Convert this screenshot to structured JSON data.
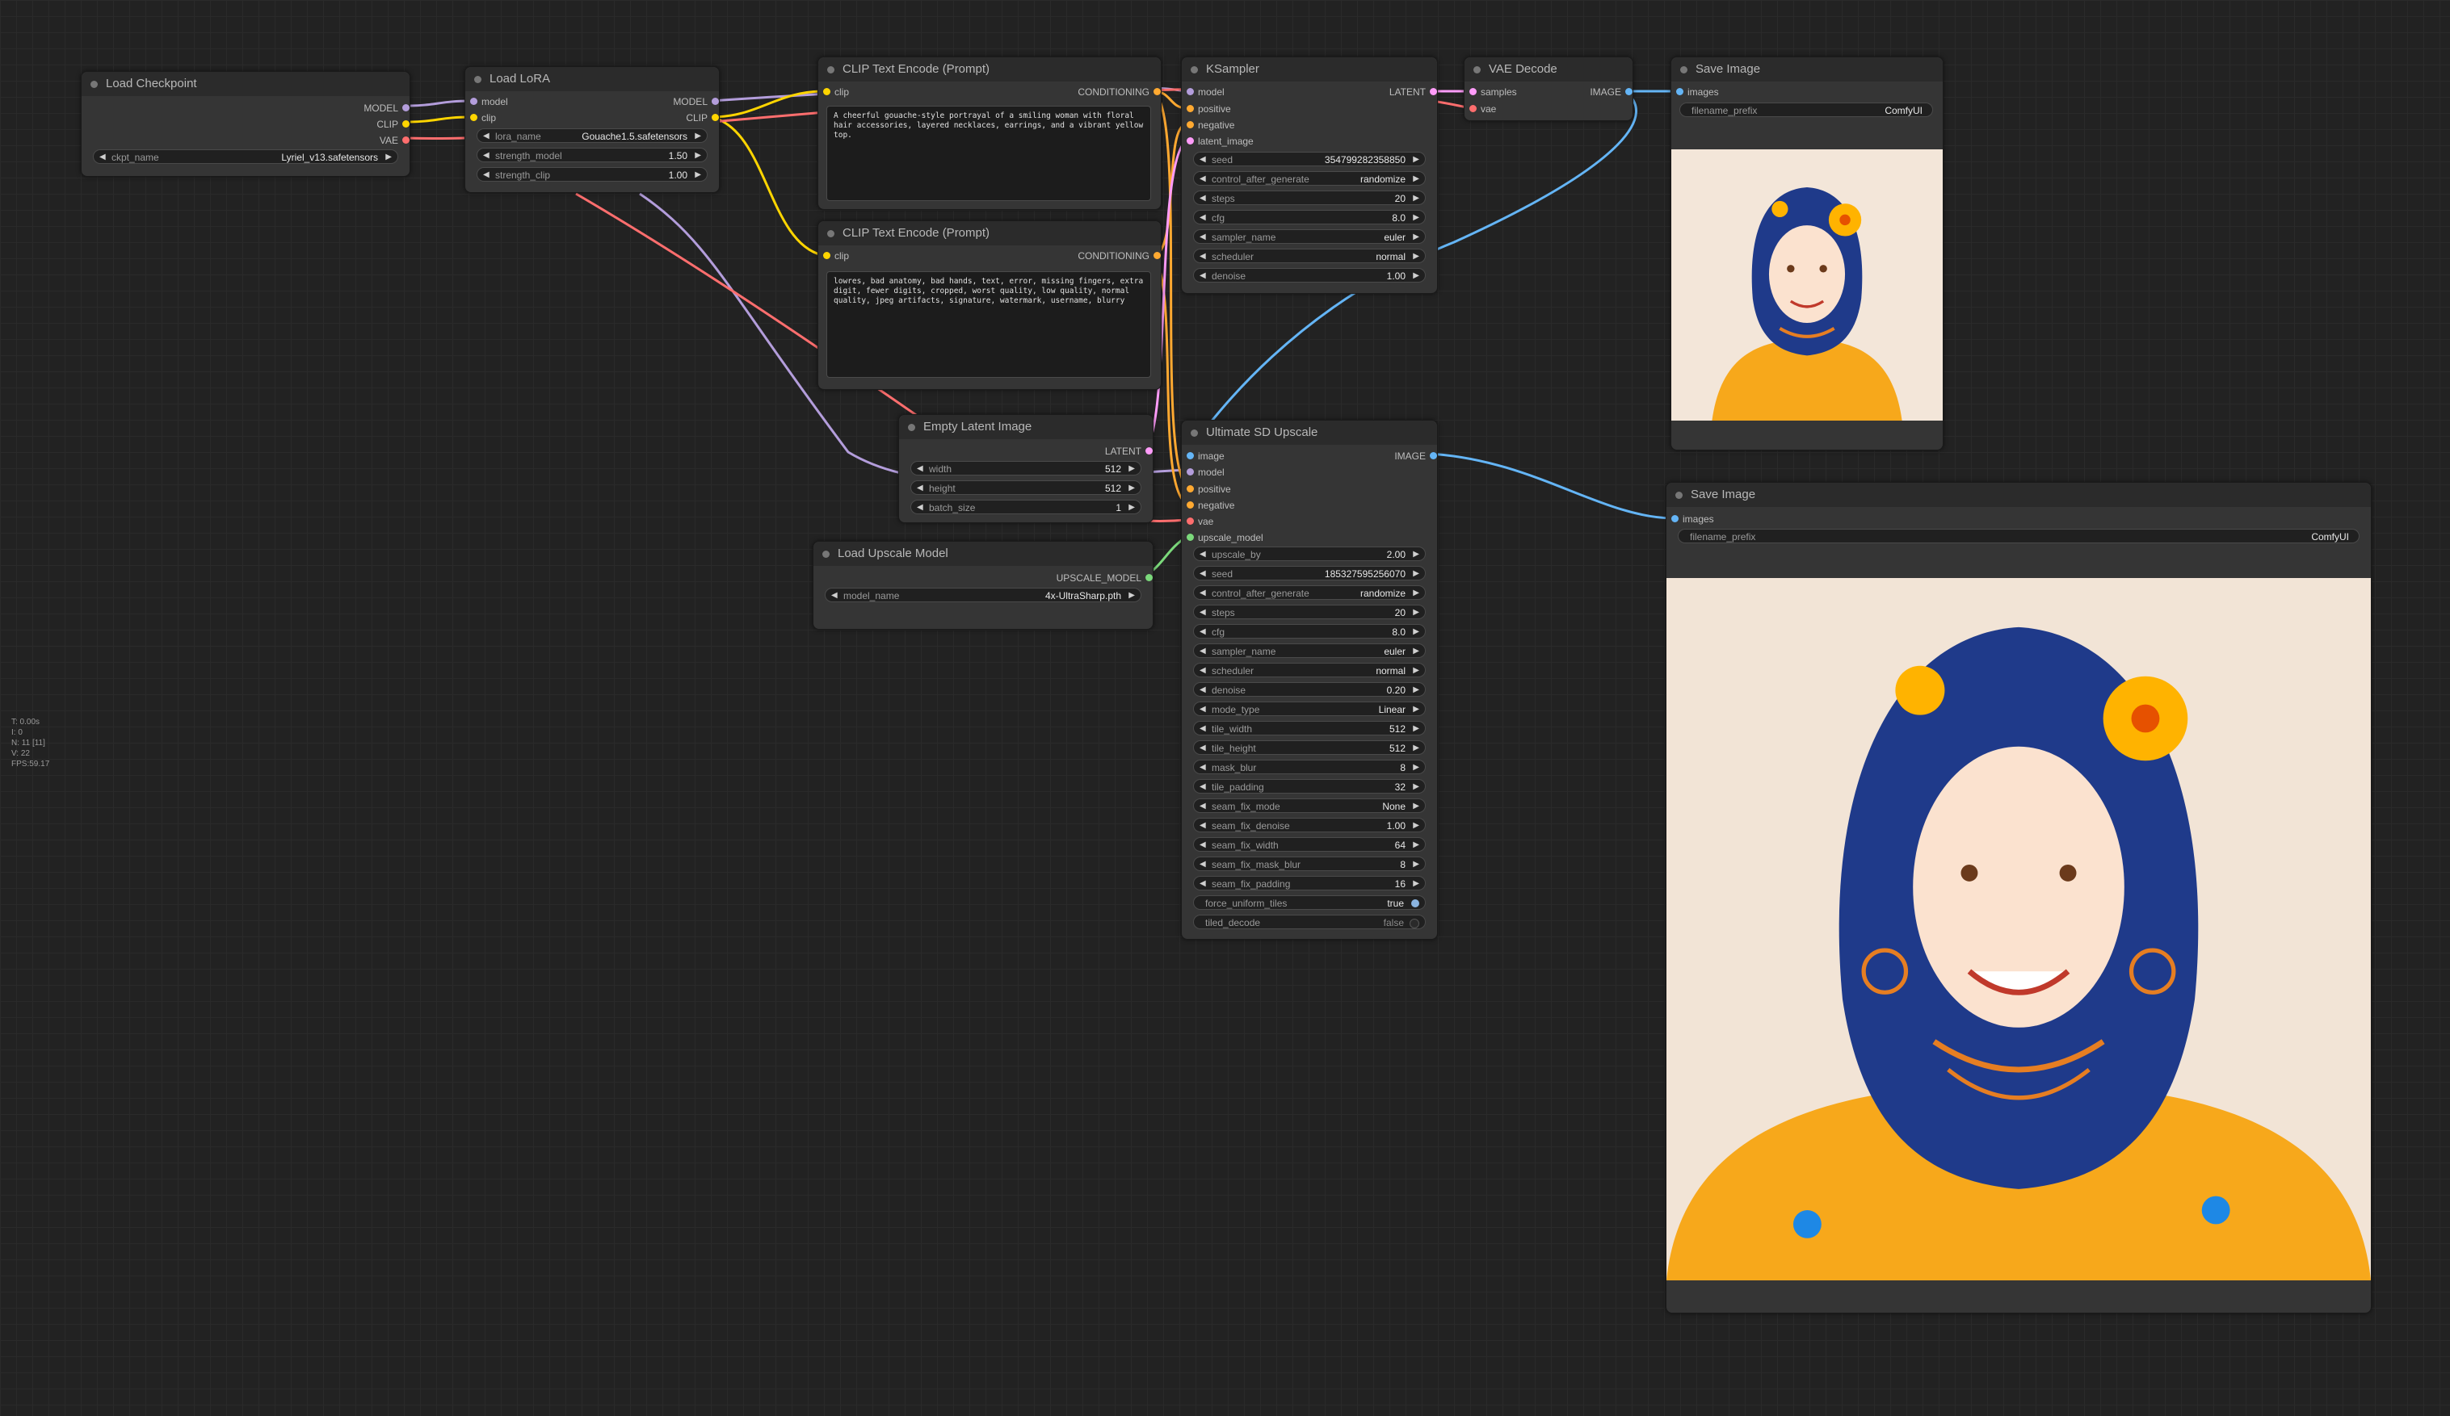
{
  "colors": {
    "model": "#b39ddb",
    "clip": "#ffd500",
    "vae": "#ff6e6e",
    "conditioning": "#ffa931",
    "latent": "#ff9cf9",
    "image": "#64b5f6",
    "upscale_model": "#7bd97b"
  },
  "stats": [
    "T: 0.00s",
    "I: 0",
    "N: 11 [11]",
    "V: 22",
    "FPS:59.17"
  ],
  "nodes": {
    "load_checkpoint": {
      "title": "Load Checkpoint",
      "outputs": [
        "MODEL",
        "CLIP",
        "VAE"
      ],
      "widgets": [
        {
          "label": "ckpt_name",
          "value": "Lyriel_v13.safetensors"
        }
      ]
    },
    "load_lora": {
      "title": "Load LoRA",
      "inputs": [
        "model",
        "clip"
      ],
      "outputs": [
        "MODEL",
        "CLIP"
      ],
      "widgets": [
        {
          "label": "lora_name",
          "value": "Gouache1.5.safetensors"
        },
        {
          "label": "strength_model",
          "value": "1.50"
        },
        {
          "label": "strength_clip",
          "value": "1.00"
        }
      ]
    },
    "clip_pos": {
      "title": "CLIP Text Encode (Prompt)",
      "input": "clip",
      "output": "CONDITIONING",
      "text": "A cheerful gouache-style portrayal of a smiling woman with floral hair accessories, layered necklaces, earrings, and a vibrant yellow top."
    },
    "clip_neg": {
      "title": "CLIP Text Encode (Prompt)",
      "input": "clip",
      "output": "CONDITIONING",
      "text": "lowres, bad anatomy, bad hands, text, error, missing fingers, extra digit, fewer digits, cropped, worst quality, low quality, normal quality, jpeg artifacts, signature, watermark, username, blurry"
    },
    "ksampler": {
      "title": "KSampler",
      "inputs": [
        "model",
        "positive",
        "negative",
        "latent_image"
      ],
      "output": "LATENT",
      "widgets": [
        {
          "label": "seed",
          "value": "354799282358850"
        },
        {
          "label": "control_after_generate",
          "value": "randomize"
        },
        {
          "label": "steps",
          "value": "20"
        },
        {
          "label": "cfg",
          "value": "8.0"
        },
        {
          "label": "sampler_name",
          "value": "euler"
        },
        {
          "label": "scheduler",
          "value": "normal"
        },
        {
          "label": "denoise",
          "value": "1.00"
        }
      ]
    },
    "vae_decode": {
      "title": "VAE Decode",
      "inputs": [
        "samples",
        "vae"
      ],
      "output": "IMAGE"
    },
    "save1": {
      "title": "Save Image",
      "input": "images",
      "widget": {
        "label": "filename_prefix",
        "value": "ComfyUI"
      }
    },
    "empty_latent": {
      "title": "Empty Latent Image",
      "output": "LATENT",
      "widgets": [
        {
          "label": "width",
          "value": "512"
        },
        {
          "label": "height",
          "value": "512"
        },
        {
          "label": "batch_size",
          "value": "1"
        }
      ]
    },
    "load_upscale": {
      "title": "Load Upscale Model",
      "output": "UPSCALE_MODEL",
      "widgets": [
        {
          "label": "model_name",
          "value": "4x-UltraSharp.pth"
        }
      ]
    },
    "usd": {
      "title": "Ultimate SD Upscale",
      "inputs": [
        "image",
        "model",
        "positive",
        "negative",
        "vae",
        "upscale_model"
      ],
      "output": "IMAGE",
      "widgets": [
        {
          "label": "upscale_by",
          "value": "2.00"
        },
        {
          "label": "seed",
          "value": "185327595256070"
        },
        {
          "label": "control_after_generate",
          "value": "randomize"
        },
        {
          "label": "steps",
          "value": "20"
        },
        {
          "label": "cfg",
          "value": "8.0"
        },
        {
          "label": "sampler_name",
          "value": "euler"
        },
        {
          "label": "scheduler",
          "value": "normal"
        },
        {
          "label": "denoise",
          "value": "0.20"
        },
        {
          "label": "mode_type",
          "value": "Linear"
        },
        {
          "label": "tile_width",
          "value": "512"
        },
        {
          "label": "tile_height",
          "value": "512"
        },
        {
          "label": "mask_blur",
          "value": "8"
        },
        {
          "label": "tile_padding",
          "value": "32"
        },
        {
          "label": "seam_fix_mode",
          "value": "None"
        },
        {
          "label": "seam_fix_denoise",
          "value": "1.00"
        },
        {
          "label": "seam_fix_width",
          "value": "64"
        },
        {
          "label": "seam_fix_mask_blur",
          "value": "8"
        },
        {
          "label": "seam_fix_padding",
          "value": "16"
        }
      ],
      "toggles": [
        {
          "label": "force_uniform_tiles",
          "value": "true"
        },
        {
          "label": "tiled_decode",
          "value": "false"
        }
      ]
    },
    "save2": {
      "title": "Save Image",
      "input": "images",
      "widget": {
        "label": "filename_prefix",
        "value": "ComfyUI"
      }
    }
  }
}
